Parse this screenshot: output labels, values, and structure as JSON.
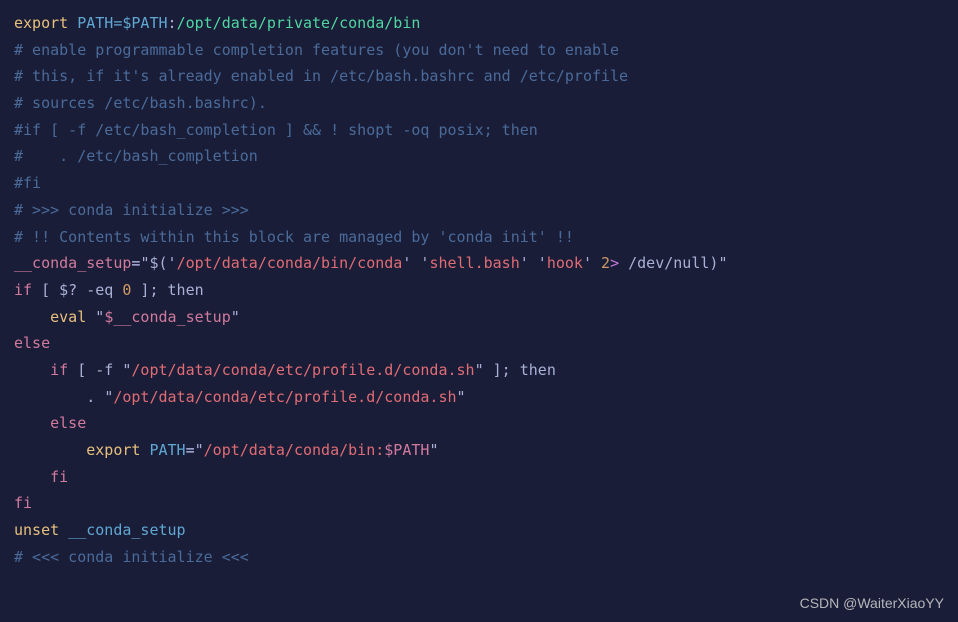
{
  "lines": {
    "l1": {
      "export": "export ",
      "pathvar": "PATH=$PATH",
      "colon": ":",
      "path": "/opt/data/private/conda/bin"
    },
    "l2": "# enable programmable completion features (you don't need to enable",
    "l3": "# this, if it's already enabled in /etc/bash.bashrc and /etc/profile",
    "l4": "# sources /etc/bash.bashrc).",
    "l5": "#if [ -f /etc/bash_completion ] && ! shopt -oq posix; then",
    "l6": "#    . /etc/bash_completion",
    "l7": "#fi",
    "l8": "",
    "l9": "# >>> conda initialize >>>",
    "l10": "# !! Contents within this block are managed by 'conda init' !!",
    "l11": {
      "var": "__conda_setup",
      "eq": "=",
      "q1": "\"",
      "dollar": "$(",
      "q2": "'",
      "p1": "/opt/data/conda/bin/conda",
      "q3": "' '",
      "p2": "shell.bash",
      "q4": "' '",
      "p3": "hook",
      "q5": "' ",
      "two": "2",
      "gt": "> ",
      "devnull": "/dev/null",
      "close": ")",
      "q6": "\""
    },
    "l12": {
      "if": "if",
      "b1": " [ ",
      "dq": "$?",
      "eq": " -eq ",
      "zero": "0",
      "b2": " ]; ",
      "then": "then"
    },
    "l13": {
      "pad": "    ",
      "eval": "eval ",
      "q1": "\"",
      "d": "$__conda_setup",
      "q2": "\""
    },
    "l14": "else",
    "l15": {
      "pad": "    ",
      "if": "if",
      "b1": " [ -f ",
      "q1": "\"",
      "path": "/opt/data/conda/etc/profile.d/conda.sh",
      "q2": "\"",
      "b2": " ]; ",
      "then": "then"
    },
    "l16": {
      "pad": "        ",
      "dot": ". ",
      "q1": "\"",
      "path": "/opt/data/conda/etc/profile.d/conda.sh",
      "q2": "\""
    },
    "l17": {
      "pad": "    ",
      "else": "else"
    },
    "l18": {
      "pad": "        ",
      "export": "export ",
      "pathvar": "PATH",
      "eq": "=",
      "q1": "\"",
      "path": "/opt/data/conda/bin:",
      "dpath": "$PATH",
      "q2": "\""
    },
    "l19": {
      "pad": "    ",
      "fi": "fi"
    },
    "l20": "fi",
    "l21": {
      "unset": "unset ",
      "var": "__conda_setup"
    },
    "l22": "# <<< conda initialize <<<"
  },
  "watermark": "CSDN @WaiterXiaoYY"
}
